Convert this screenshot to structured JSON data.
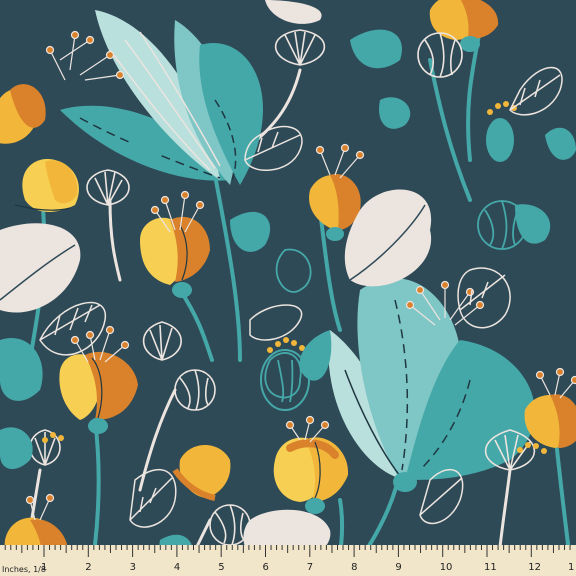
{
  "colors": {
    "background": "#2f4a57",
    "teal": "#45a8a8",
    "teal_light": "#7fc6c6",
    "mint": "#b9e0dc",
    "yellow": "#f2b73a",
    "yellow_light": "#f7cf52",
    "orange": "#d9822b",
    "cream": "#ece4df",
    "line": "#1f3742",
    "ruler": "#f1e6c9"
  },
  "ruler": {
    "unit_label": "Inches, 1/8",
    "numbers": [
      "1",
      "2",
      "3",
      "4",
      "5",
      "6",
      "7",
      "8",
      "9",
      "10",
      "11",
      "12",
      "1"
    ]
  },
  "motifs": {
    "tulips": [
      {
        "variant": "large-teal"
      },
      {
        "variant": "large-teal"
      },
      {
        "variant": "yellow"
      },
      {
        "variant": "yellow"
      },
      {
        "variant": "yellow"
      },
      {
        "variant": "yellow"
      },
      {
        "variant": "yellow"
      },
      {
        "variant": "yellow"
      },
      {
        "variant": "yellow"
      },
      {
        "variant": "yellow"
      }
    ],
    "pods": 9,
    "leaves": 12
  }
}
